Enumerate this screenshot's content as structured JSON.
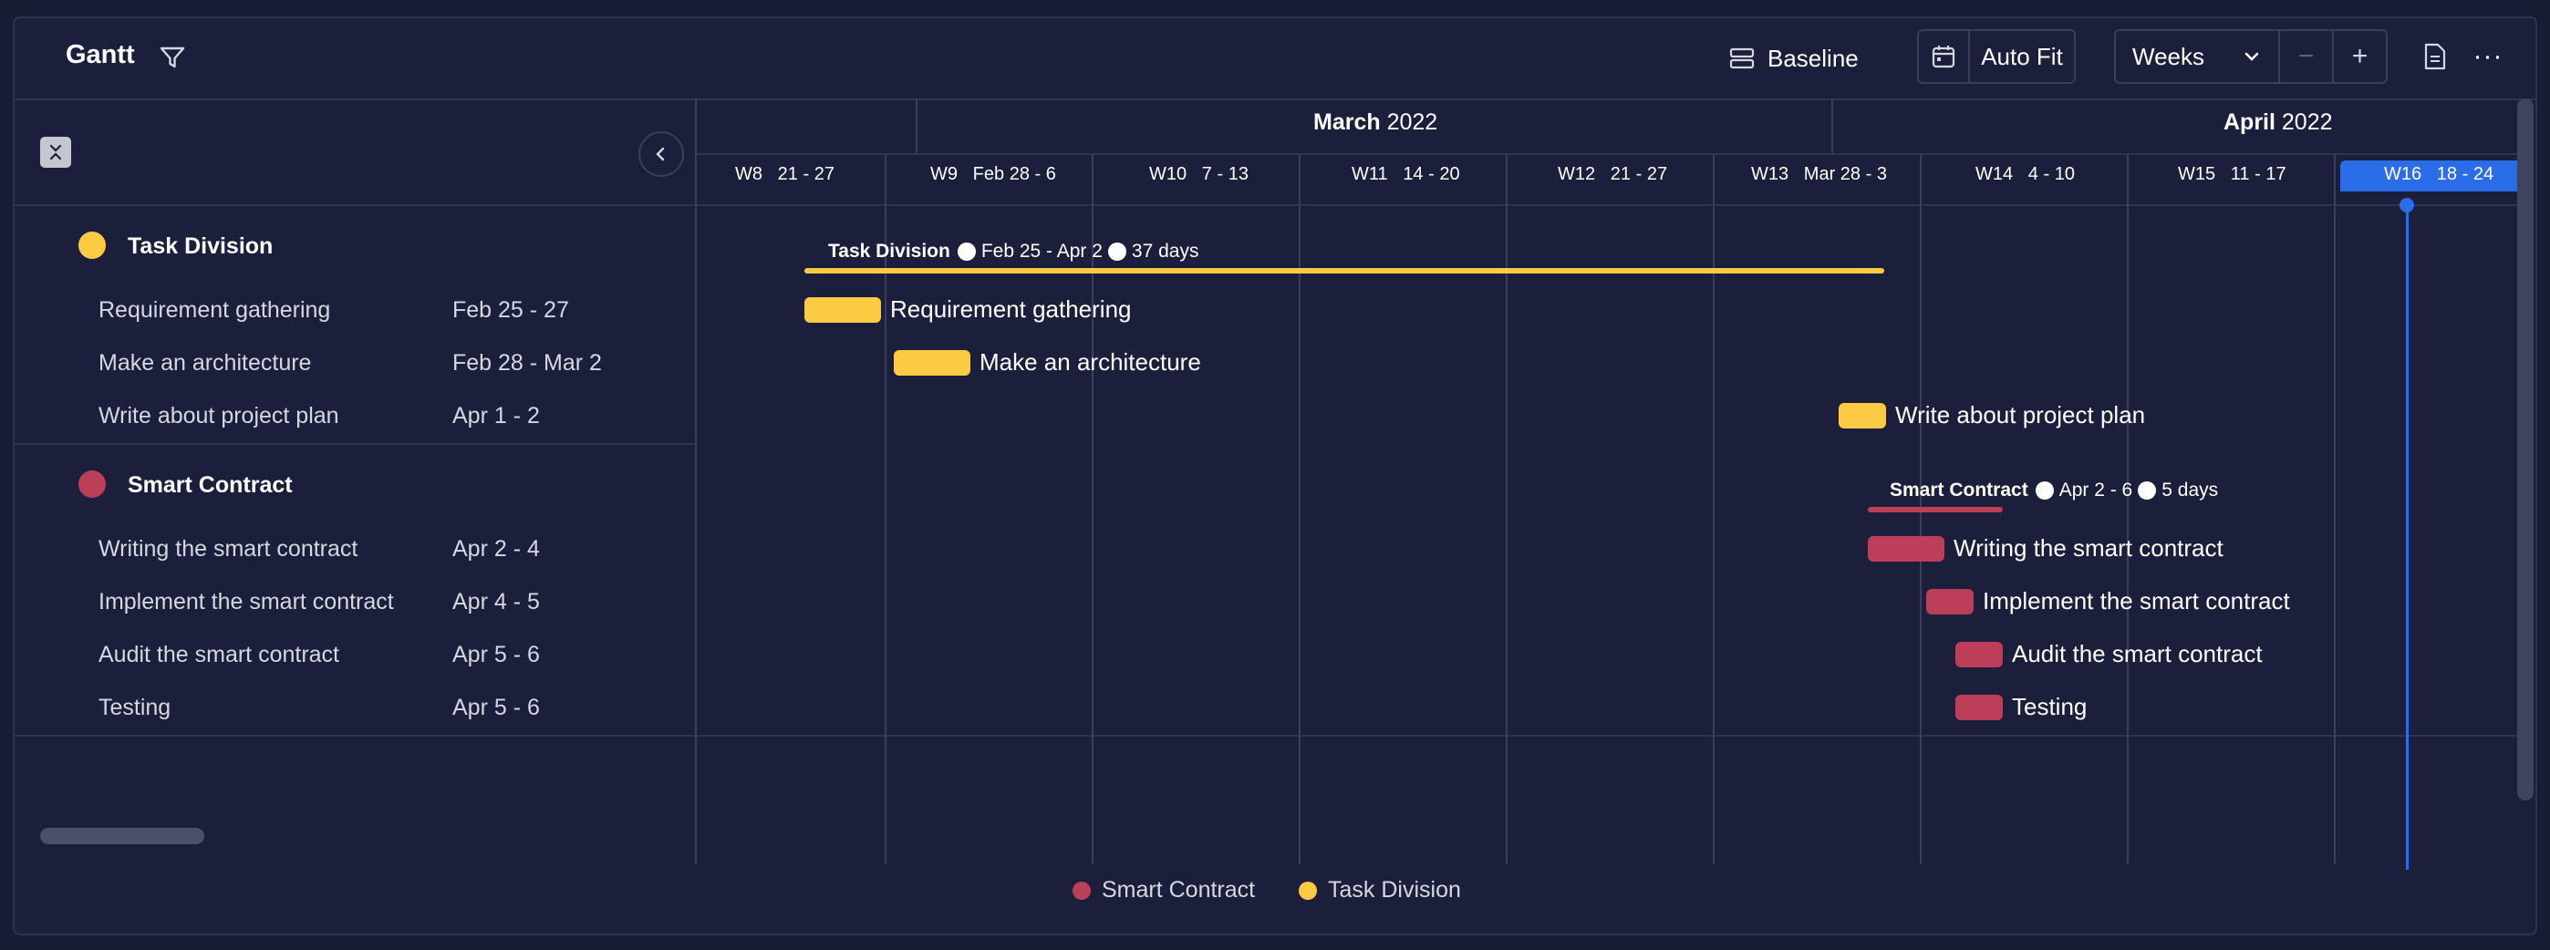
{
  "header": {
    "title": "Gantt",
    "baseline_label": "Baseline",
    "autofit_label": "Auto Fit",
    "zoom_value": "Weeks",
    "zoom_minus": "−",
    "zoom_plus": "+",
    "more": "···"
  },
  "timeline": {
    "months": [
      {
        "name": "March",
        "year": "2022"
      },
      {
        "name": "April",
        "year": "2022"
      }
    ],
    "weeks": [
      {
        "week": "W8",
        "range": "21 - 27"
      },
      {
        "week": "W9",
        "range": "Feb 28 - 6"
      },
      {
        "week": "W10",
        "range": "7 - 13"
      },
      {
        "week": "W11",
        "range": "14 - 20"
      },
      {
        "week": "W12",
        "range": "21 - 27"
      },
      {
        "week": "W13",
        "range": "Mar 28 - 3"
      },
      {
        "week": "W14",
        "range": "4 - 10"
      },
      {
        "week": "W15",
        "range": "11 - 17"
      },
      {
        "week": "W16",
        "range": "18 - 24"
      }
    ],
    "current_week": "W16"
  },
  "groups": [
    {
      "name": "Task Division",
      "color": "#fdca44",
      "summary_range": "Feb 25 - Apr 2",
      "summary_duration": "37 days",
      "tasks": [
        {
          "name": "Requirement gathering",
          "date": "Feb 25 - 27"
        },
        {
          "name": "Make an architecture",
          "date": "Feb 28 - Mar 2"
        },
        {
          "name": "Write about project plan",
          "date": "Apr 1 - 2"
        }
      ]
    },
    {
      "name": "Smart Contract",
      "color": "#bd3e59",
      "summary_range": "Apr 2 - 6",
      "summary_duration": "5 days",
      "tasks": [
        {
          "name": "Writing the smart contract",
          "date": "Apr 2 - 4"
        },
        {
          "name": "Implement the smart contract",
          "date": "Apr 4 - 5"
        },
        {
          "name": "Audit the smart contract",
          "date": "Apr 5 - 6"
        },
        {
          "name": "Testing",
          "date": "Apr 5 - 6"
        }
      ]
    }
  ],
  "legend": [
    {
      "label": "Smart Contract",
      "color": "#bd3e59"
    },
    {
      "label": "Task Division",
      "color": "#fdca44"
    }
  ]
}
